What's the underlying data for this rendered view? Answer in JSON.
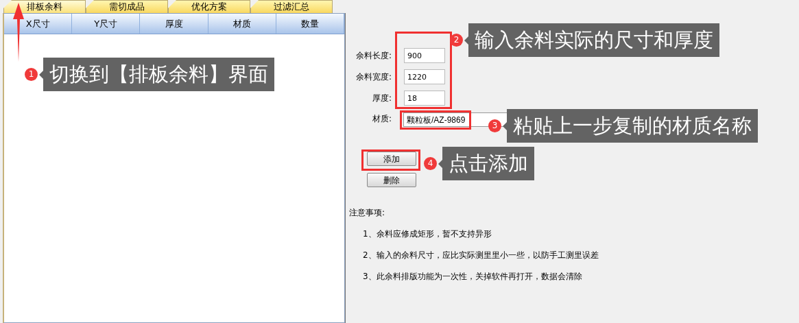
{
  "tabs": [
    {
      "label": "排板余料",
      "selected": true
    },
    {
      "label": "需切成品",
      "selected": false
    },
    {
      "label": "优化方案",
      "selected": false
    },
    {
      "label": "过滤汇总",
      "selected": false
    }
  ],
  "table": {
    "columns": [
      "X尺寸",
      "Y尺寸",
      "厚度",
      "材质",
      "数量"
    ]
  },
  "form": {
    "fields": [
      {
        "label": "余料长度:",
        "value": "900"
      },
      {
        "label": "余料宽度:",
        "value": "1220"
      },
      {
        "label": "厚度:",
        "value": "18"
      }
    ],
    "material": {
      "label": "材质:",
      "value": "颗粒板/AZ-9869"
    },
    "buttons": [
      "添加",
      "删除"
    ]
  },
  "notes": {
    "title": "注意事项:",
    "items": [
      "1、余料应修成矩形，暂不支持异形",
      "2、输入的余料尺寸，应比实际测里里小一些，以防手工测里误差",
      "3、此余料排版功能为一次性，关掉软件再打开，数据会清除"
    ]
  },
  "annotations": [
    {
      "number": "1",
      "text": "切换到【排板余料】界面"
    },
    {
      "number": "2",
      "text": "输入余料实际的尺寸和厚度"
    },
    {
      "number": "3",
      "text": "粘贴上一步复制的材质名称"
    },
    {
      "number": "4",
      "text": "点击添加"
    }
  ]
}
